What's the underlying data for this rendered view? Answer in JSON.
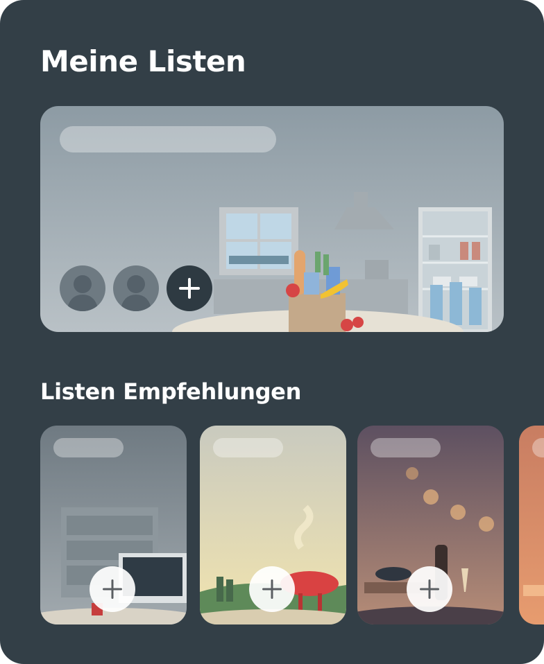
{
  "page": {
    "title": "Meine Listen",
    "recommendations_title": "Listen Empfehlungen"
  },
  "my_list": {
    "scene": "kitchen",
    "members": [
      {
        "avatar": "person-icon"
      },
      {
        "avatar": "person-icon"
      }
    ],
    "add_member_icon": "plus-icon"
  },
  "recommendations": [
    {
      "scene": "office",
      "add_icon": "plus-icon"
    },
    {
      "scene": "barbecue",
      "add_icon": "plus-icon"
    },
    {
      "scene": "party",
      "add_icon": "plus-icon"
    },
    {
      "scene": "partial-card",
      "add_icon": "plus-icon"
    }
  ],
  "colors": {
    "background": "#333F47",
    "accent_dark": "#2E3A42",
    "text": "#FFFFFF"
  }
}
